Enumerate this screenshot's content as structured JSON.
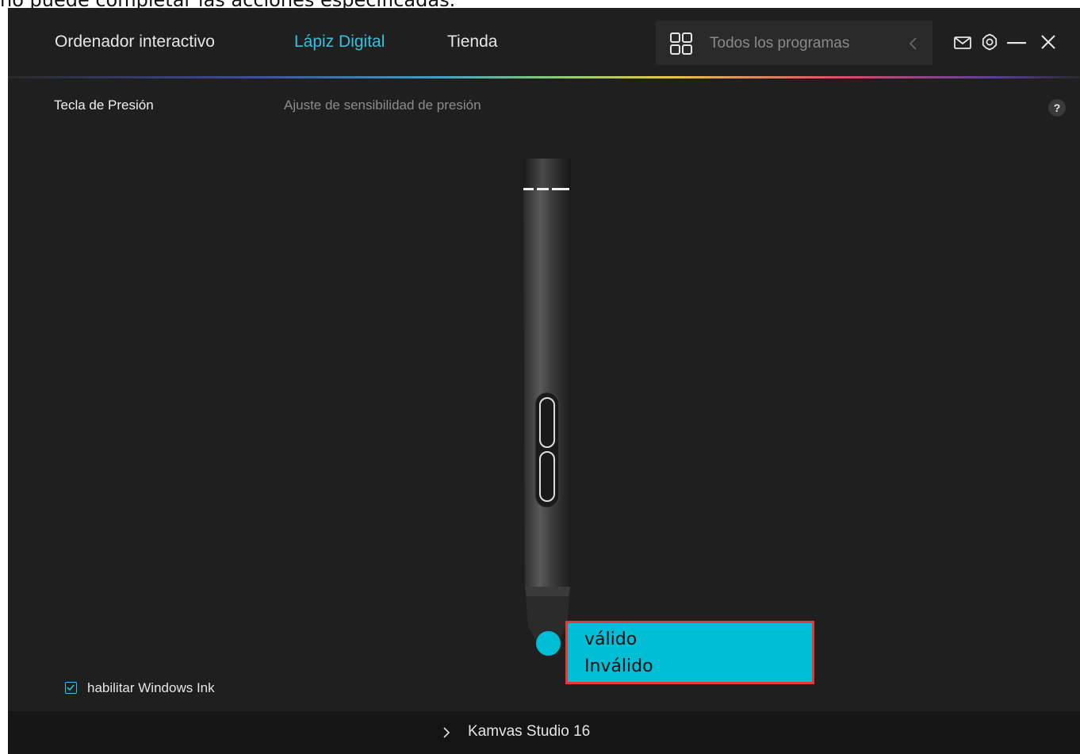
{
  "caption": "no puede completar las acciones especificadas.",
  "header": {
    "tabs": [
      {
        "label": "Ordenador interactivo",
        "active": false
      },
      {
        "label": "Lápiz Digital",
        "active": true
      },
      {
        "label": "Tienda",
        "active": false
      }
    ],
    "search": {
      "placeholder": "Todos los programas",
      "icon": "grid-icon"
    },
    "window_icons": [
      "mail-icon",
      "gear-icon",
      "minimize-icon",
      "close-icon"
    ]
  },
  "subheader": {
    "section_title": "Tecla de Presión",
    "section_subtitle": "Ajuste de sensibilidad de presión",
    "help_label": "?"
  },
  "pen_tip_menu": {
    "options": [
      "válido",
      "Inválido"
    ]
  },
  "windows_ink": {
    "label": "habilitar Windows Ink",
    "checked": true
  },
  "footer": {
    "device_name": "Kamvas Studio 16"
  },
  "colors": {
    "accent": "#2fc3df",
    "app_background": "#1f1f1f",
    "dropdown_background": "#00bed6",
    "highlight_border": "#e53935",
    "tip_dot": "#00bcd4"
  }
}
